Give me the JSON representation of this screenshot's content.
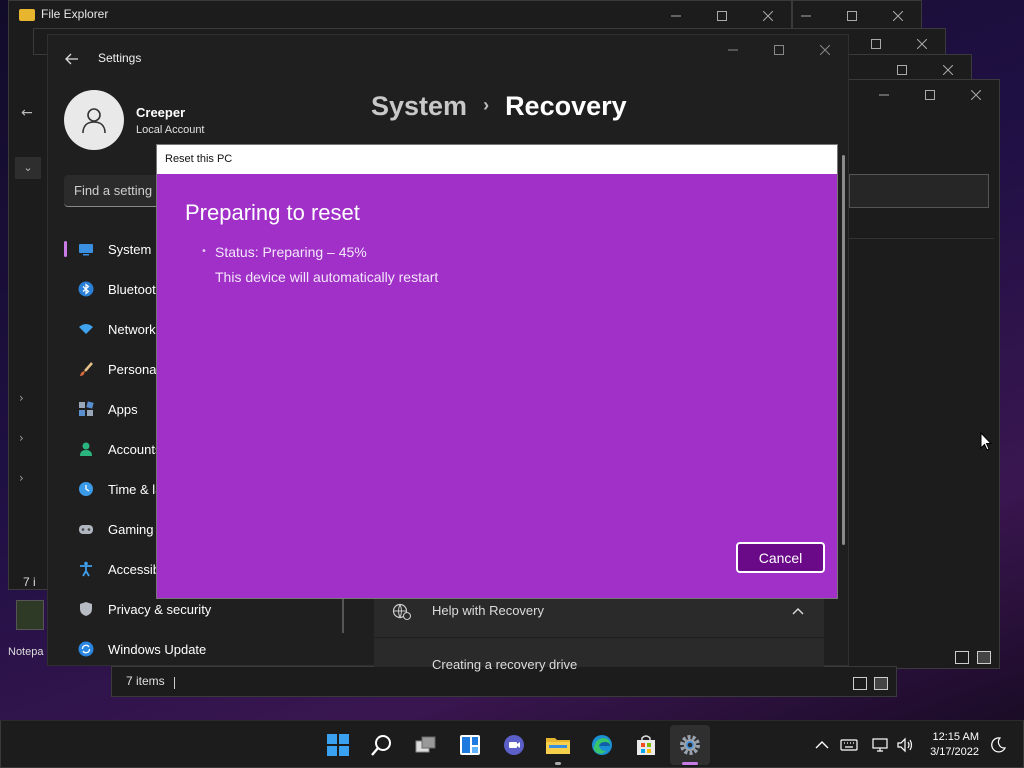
{
  "explorer": {
    "title": "File Explorer",
    "status_items": "7 items",
    "status_items_short": "7 i"
  },
  "desktop": {
    "notepad_label": "Notepa"
  },
  "settings": {
    "title": "Settings",
    "user": {
      "name": "Creeper",
      "account": "Local Account"
    },
    "search_placeholder": "Find a setting",
    "breadcrumb": {
      "parent": "System",
      "current": "Recovery"
    },
    "nav": [
      {
        "label": "System",
        "icon": "monitor-icon"
      },
      {
        "label": "Bluetooth & devices",
        "icon": "bluetooth-icon"
      },
      {
        "label": "Network & internet",
        "icon": "wifi-icon"
      },
      {
        "label": "Personalization",
        "icon": "brush-icon"
      },
      {
        "label": "Apps",
        "icon": "apps-icon"
      },
      {
        "label": "Accounts",
        "icon": "person-icon"
      },
      {
        "label": "Time & language",
        "icon": "clock-globe-icon"
      },
      {
        "label": "Gaming",
        "icon": "gamepad-icon"
      },
      {
        "label": "Accessibility",
        "icon": "accessibility-icon"
      },
      {
        "label": "Privacy & security",
        "icon": "shield-icon"
      },
      {
        "label": "Windows Update",
        "icon": "update-icon"
      }
    ],
    "help": {
      "label": "Help with Recovery",
      "item": "Creating a recovery drive"
    }
  },
  "dialog": {
    "title": "Reset this PC",
    "heading": "Preparing to reset",
    "status": "Status: Preparing – 45%",
    "note": "This device will automatically restart",
    "cancel_label": "Cancel",
    "progress_percent": 45
  },
  "taskbar": {
    "time": "12:15 AM",
    "date": "3/17/2022",
    "apps": [
      "windows-start-icon",
      "search-icon",
      "task-view-icon",
      "widgets-icon",
      "teams-chat-icon",
      "file-explorer-icon",
      "edge-icon",
      "store-icon",
      "settings-icon"
    ]
  },
  "colors": {
    "dialog_bg": "#a030c8",
    "cancel_bg": "#6a0a88",
    "accent": "#c87ce6"
  }
}
